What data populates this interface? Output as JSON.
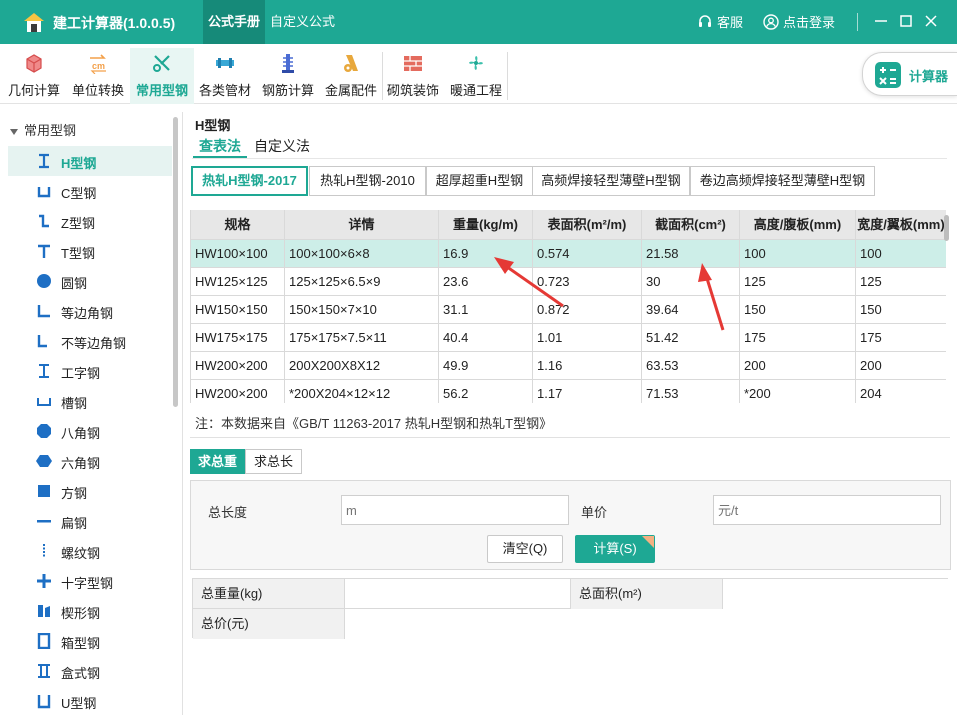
{
  "app": {
    "title": "建工计算器(1.0.0.5)",
    "menu": [
      "公式手册",
      "自定义公式"
    ],
    "support_label": "客服",
    "login_label": "点击登录",
    "accent": "#1ea894"
  },
  "toolbar": {
    "items": [
      {
        "label": "几何计算",
        "icon": "cube-icon"
      },
      {
        "label": "单位转换",
        "icon": "cm-convert-icon"
      },
      {
        "label": "常用型钢",
        "icon": "tools-icon"
      },
      {
        "label": "各类管材",
        "icon": "pipe-icon"
      },
      {
        "label": "钢筋计算",
        "icon": "rebar-icon"
      },
      {
        "label": "金属配件",
        "icon": "fitting-icon"
      },
      {
        "label": "砌筑装饰",
        "icon": "brick-icon"
      },
      {
        "label": "暖通工程",
        "icon": "fan-icon"
      }
    ],
    "calculator_label": "计算器"
  },
  "sidebar": {
    "root": "常用型钢",
    "items": [
      {
        "label": "H型钢",
        "icon": "h-beam-icon"
      },
      {
        "label": "C型钢",
        "icon": "c-channel-icon"
      },
      {
        "label": "Z型钢",
        "icon": "z-section-icon"
      },
      {
        "label": "T型钢",
        "icon": "t-section-icon"
      },
      {
        "label": "圆钢",
        "icon": "round-bar-icon"
      },
      {
        "label": "等边角钢",
        "icon": "equal-angle-icon"
      },
      {
        "label": "不等边角钢",
        "icon": "unequal-angle-icon"
      },
      {
        "label": "工字钢",
        "icon": "i-beam-icon"
      },
      {
        "label": "槽钢",
        "icon": "channel-icon"
      },
      {
        "label": "八角钢",
        "icon": "octagon-bar-icon"
      },
      {
        "label": "六角钢",
        "icon": "hexagon-bar-icon"
      },
      {
        "label": "方钢",
        "icon": "square-bar-icon"
      },
      {
        "label": "扁钢",
        "icon": "flat-bar-icon"
      },
      {
        "label": "螺纹钢",
        "icon": "rebar-thread-icon"
      },
      {
        "label": "十字型钢",
        "icon": "cross-section-icon"
      },
      {
        "label": "楔形钢",
        "icon": "wedge-section-icon"
      },
      {
        "label": "箱型钢",
        "icon": "box-section-icon"
      },
      {
        "label": "盒式钢",
        "icon": "box-type-icon"
      },
      {
        "label": "U型钢",
        "icon": "u-section-icon"
      }
    ]
  },
  "main": {
    "section_title": "H型钢",
    "method_tabs": [
      "查表法",
      "自定义法"
    ],
    "standard_tabs": [
      "热轧H型钢-2017",
      "热轧H型钢-2010",
      "超厚超重H型钢",
      "高频焊接轻型薄壁H型钢",
      "卷边高频焊接轻型薄壁H型钢"
    ],
    "table": {
      "headers": [
        "规格",
        "详情",
        "重量(kg/m)",
        "表面积(m²/m)",
        "截面积(cm²)",
        "高度/腹板(mm)",
        "宽度/翼板(mm)"
      ],
      "rows": [
        [
          "HW100×100",
          "100×100×6×8",
          "16.9",
          "0.574",
          "21.58",
          "100",
          "100"
        ],
        [
          "HW125×125",
          "125×125×6.5×9",
          "23.6",
          "0.723",
          "30",
          "125",
          "125"
        ],
        [
          "HW150×150",
          "150×150×7×10",
          "31.1",
          "0.872",
          "39.64",
          "150",
          "150"
        ],
        [
          "HW175×175",
          "175×175×7.5×11",
          "40.4",
          "1.01",
          "51.42",
          "175",
          "175"
        ],
        [
          "HW200×200",
          "200X200X8X12",
          "49.9",
          "1.16",
          "63.53",
          "200",
          "200"
        ],
        [
          "HW200×200",
          "*200X204×12×12",
          "56.2",
          "1.17",
          "71.53",
          "*200",
          "204"
        ]
      ]
    },
    "source_note": "注：本数据来自《GB/T 11263-2017 热轧H型钢和热轧T型钢》",
    "sum_tabs": [
      "求总重",
      "求总长"
    ],
    "form": {
      "length_label": "总长度",
      "length_placeholder": "m",
      "price_label": "单价",
      "price_placeholder": "元/t",
      "clear_label": "清空(Q)",
      "calc_label": "计算(S)"
    },
    "result": {
      "weight_label": "总重量(kg)",
      "area_label": "总面积(m²)",
      "price_label": "总价(元)"
    }
  }
}
